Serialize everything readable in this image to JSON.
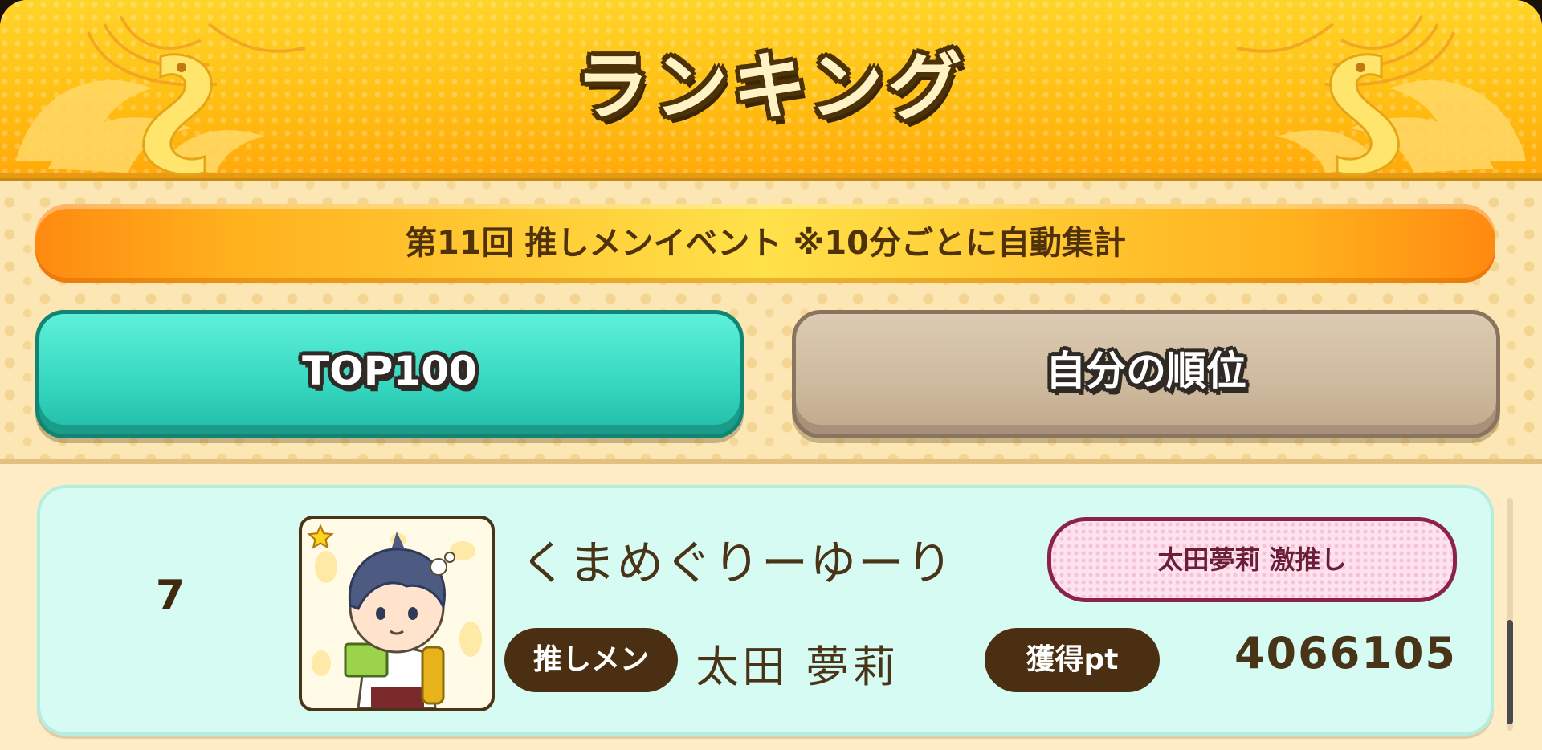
{
  "header": {
    "title": "ランキング"
  },
  "event_banner": {
    "text": "第11回 推しメンイベント ※10分ごとに自動集計"
  },
  "tabs": [
    {
      "label": "TOP100",
      "active": true
    },
    {
      "label": "自分の順位",
      "active": false
    }
  ],
  "ranking": [
    {
      "rank": "7",
      "user_name": "くまめぐりーゆーり",
      "fan_badge": "太田夢莉 激推し",
      "oshi_label": "推しメン",
      "oshi_name": "太田 夢莉",
      "points_label": "獲得pt",
      "points": "4066105"
    }
  ],
  "colors": {
    "header_yellow": "#ffc21a",
    "tab_active": "#35d6bf",
    "tab_inactive": "#cdb99d",
    "card_bg": "#d5fbf3",
    "pill_brown": "#4a2f12",
    "badge_pink": "#fde3ee"
  },
  "icons": [
    "phoenix-ornament-icon",
    "star-icon",
    "avatar-character-icon"
  ]
}
